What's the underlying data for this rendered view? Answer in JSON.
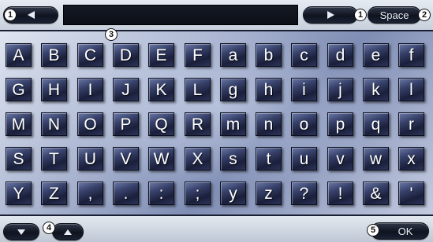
{
  "top_bar": {
    "space_label": "Space",
    "input_value": "",
    "left_arrow_callout": "1",
    "right_arrow_callout": "1",
    "space_callout": "2",
    "keys_callout": "3"
  },
  "keys": [
    [
      "A",
      "B",
      "C",
      "D",
      "E",
      "F",
      "a",
      "b",
      "c",
      "d",
      "e",
      "f"
    ],
    [
      "G",
      "H",
      "I",
      "J",
      "K",
      "L",
      "g",
      "h",
      "i",
      "j",
      "k",
      "l"
    ],
    [
      "M",
      "N",
      "O",
      "P",
      "Q",
      "R",
      "m",
      "n",
      "o",
      "p",
      "q",
      "r"
    ],
    [
      "S",
      "T",
      "U",
      "V",
      "W",
      "X",
      "s",
      "t",
      "u",
      "v",
      "w",
      "x"
    ],
    [
      "Y",
      "Z",
      ",",
      ".",
      ":",
      ";",
      "y",
      "z",
      "?",
      "!",
      "&",
      "'"
    ]
  ],
  "bottom_bar": {
    "ok_label": "OK",
    "page_callout": "4",
    "ok_callout": "5"
  },
  "colors": {
    "key_face": "#1a1f3b",
    "key_text": "#ffffff",
    "button_dark": "#0f1320"
  },
  "icons": {
    "prev_cursor": "triangle-left-icon",
    "next_cursor": "triangle-right-icon",
    "page_down": "triangle-down-icon",
    "page_up": "triangle-up-icon"
  }
}
